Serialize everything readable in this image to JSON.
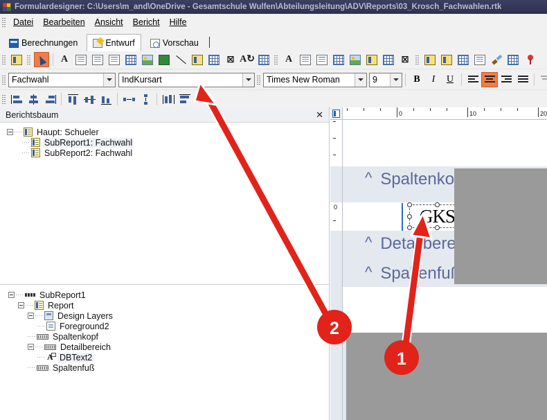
{
  "window": {
    "title": "Formulardesigner: C:\\Users\\m_and\\OneDrive - Gesamtschule Wulfen\\Abteilungsleitung\\ADV\\Reports\\03_Krosch_Fachwahlen.rtk",
    "icon": "app-icon"
  },
  "menu": {
    "items": [
      {
        "label": "Datei"
      },
      {
        "label": "Bearbeiten"
      },
      {
        "label": "Ansicht"
      },
      {
        "label": "Bericht"
      },
      {
        "label": "Hilfe"
      }
    ]
  },
  "tabs": [
    {
      "label": "Berechnungen",
      "icon": "calculator-icon",
      "active": false
    },
    {
      "label": "Entwurf",
      "icon": "design-pencil-icon",
      "active": true
    },
    {
      "label": "Vorschau",
      "icon": "preview-magnifier-icon",
      "active": false
    }
  ],
  "toolbar_objects": {
    "icons": [
      {
        "name": "report-structure-icon"
      },
      {
        "name": "select-pointer-icon",
        "selected": true
      },
      {
        "name": "label-text-icon"
      },
      {
        "name": "memo-icon"
      },
      {
        "name": "richtext-icon"
      },
      {
        "name": "dbtext-icon"
      },
      {
        "name": "dbcalc-icon"
      },
      {
        "name": "image-icon"
      },
      {
        "name": "shape-icon"
      },
      {
        "name": "line-icon"
      },
      {
        "name": "barcode-icon"
      },
      {
        "name": "checkbox-image-icon"
      },
      {
        "name": "crosstab-icon"
      },
      {
        "name": "rotated-text-icon"
      },
      {
        "name": "grid-table-icon"
      },
      {
        "name": "variable-text-icon"
      },
      {
        "name": "db-memo-icon"
      },
      {
        "name": "db-richtext-icon"
      },
      {
        "name": "db-calc-icon"
      },
      {
        "name": "db-image-icon"
      },
      {
        "name": "db-barcode-icon"
      },
      {
        "name": "db-checkbox-icon"
      },
      {
        "name": "db-chart-icon"
      },
      {
        "name": "subreport-icon"
      },
      {
        "name": "region-icon"
      },
      {
        "name": "page-break-icon"
      },
      {
        "name": "sketch-icon"
      },
      {
        "name": "brush-icon"
      },
      {
        "name": "table-grid-icon"
      },
      {
        "name": "map-icon"
      }
    ]
  },
  "format_bar": {
    "data_source": {
      "value": "Fachwahl",
      "name": "data-source-combo"
    },
    "data_field": {
      "value": "IndKursart",
      "name": "data-field-combo"
    },
    "font_family": {
      "value": "Times New Roman",
      "name": "font-family-combo"
    },
    "font_size": {
      "value": "9",
      "name": "font-size-combo"
    },
    "bold": {
      "label": "B",
      "active": false
    },
    "italic": {
      "label": "I",
      "active": false
    },
    "underline": {
      "label": "U",
      "active": false
    },
    "align_left": {
      "label": "align-left",
      "active": false
    },
    "align_center": {
      "label": "align-center",
      "active": true
    },
    "align_right": {
      "label": "align-right",
      "active": false
    },
    "align_justify": {
      "label": "align-justify",
      "active": false
    },
    "valign_top": {
      "label": "valign-top",
      "active": false,
      "disabled": true
    },
    "valign_center": {
      "label": "valign-center",
      "active": false,
      "disabled": true
    }
  },
  "align_bar": {
    "icons": [
      {
        "name": "align-objects-left-icon"
      },
      {
        "name": "align-objects-hcenter-icon"
      },
      {
        "name": "align-objects-right-icon"
      },
      {
        "name": "align-objects-top-icon"
      },
      {
        "name": "align-objects-vcenter-icon"
      },
      {
        "name": "align-objects-bottom-icon"
      },
      {
        "name": "space-horizontally-icon"
      },
      {
        "name": "space-vertically-icon"
      },
      {
        "name": "same-width-icon"
      },
      {
        "name": "same-height-icon"
      }
    ]
  },
  "report_tree_panel": {
    "title": "Berichtsbaum",
    "close_label": "✕",
    "nodes": [
      {
        "label": "Haupt: Schueler",
        "depth": 0,
        "expander": "minus",
        "icon": "report-icon",
        "highlight": false
      },
      {
        "label": "SubReport1: Fachwahl",
        "depth": 1,
        "expander": "none",
        "icon": "report-icon",
        "highlight": true
      },
      {
        "label": "SubReport2: Fachwahl",
        "depth": 1,
        "expander": "none",
        "icon": "report-icon",
        "highlight": false
      }
    ]
  },
  "structure_tree": {
    "nodes": [
      {
        "label": "SubReport1",
        "depth": 0,
        "expander": "minus",
        "icon": "dots-icon",
        "highlight": false
      },
      {
        "label": "Report",
        "depth": 1,
        "expander": "minus",
        "icon": "report-icon",
        "highlight": false
      },
      {
        "label": "Design Layers",
        "depth": 2,
        "expander": "minus",
        "icon": "layers-icon",
        "highlight": false
      },
      {
        "label": "Foreground2",
        "depth": 3,
        "expander": "none",
        "icon": "page-icon",
        "highlight": false
      },
      {
        "label": "Spaltenkopf",
        "depth": 2,
        "expander": "none",
        "icon": "band-icon",
        "highlight": false
      },
      {
        "label": "Detailbereich",
        "depth": 2,
        "expander": "minus",
        "icon": "band-icon",
        "highlight": false
      },
      {
        "label": "DBText2",
        "depth": 3,
        "expander": "none",
        "icon": "dbtext-icon",
        "highlight": true
      },
      {
        "label": "Spaltenfuß",
        "depth": 2,
        "expander": "none",
        "icon": "band-icon",
        "highlight": false
      }
    ]
  },
  "design_surface": {
    "hruler_labels": [
      "0",
      "10",
      "20"
    ],
    "vruler_labels": [
      "0"
    ],
    "bands": [
      {
        "label": "Spaltenkopf",
        "chevron": "^"
      },
      {
        "label": "Detailbereich",
        "chevron": "^"
      },
      {
        "label": "Spaltenfuß",
        "chevron": "^"
      }
    ],
    "selected_element": {
      "name": "DBText2",
      "text": "GKS"
    }
  },
  "annotations": [
    {
      "number": "1",
      "target": "dbtext-element-gks"
    },
    {
      "number": "2",
      "target": "data-field-combo"
    }
  ],
  "colors": {
    "titlebar": "#343856",
    "accent_selected": "#ef7d4a",
    "annotation_red": "#e2231a",
    "band_label_text": "#5a6a9a",
    "redaction_gray": "#9a9a9a"
  }
}
